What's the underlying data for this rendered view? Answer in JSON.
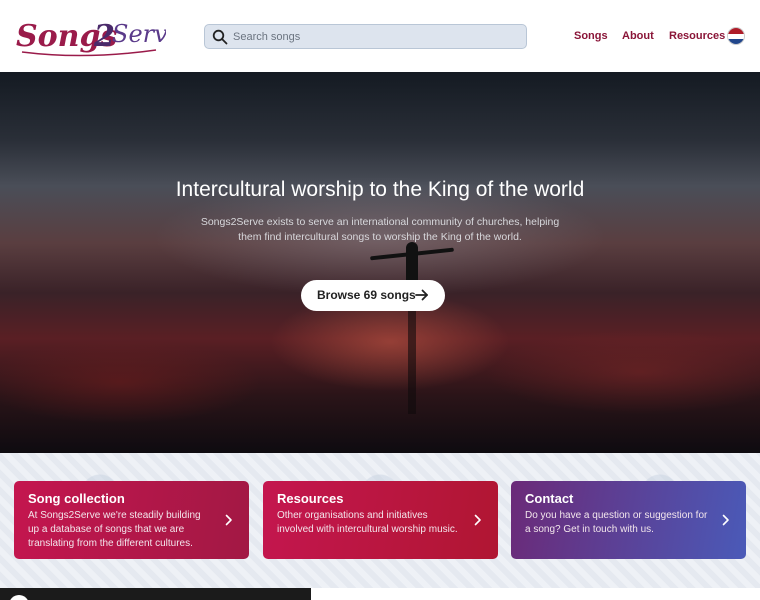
{
  "header": {
    "logo_text": "Songs2Serve",
    "search": {
      "placeholder": "Search songs",
      "value": ""
    },
    "nav": [
      {
        "label": "Songs"
      },
      {
        "label": "About"
      },
      {
        "label": "Resources"
      }
    ],
    "language_flag": "flag-netherlands-icon"
  },
  "hero": {
    "title": "Intercultural worship to the King of the world",
    "text": "Songs2Serve exists to serve an international community of churches, helping them find intercultural songs to worship the King of the world.",
    "button_label": "Browse 69 songs"
  },
  "cards": [
    {
      "title": "Song collection",
      "text": "At Songs2Serve we're steadily building up a database of songs that we are translating from the different cultures."
    },
    {
      "title": "Resources",
      "text": "Other organisations and initiatives involved with intercultural worship music."
    },
    {
      "title": "Contact",
      "text": "Do you have a question or suggestion for a song? Get in touch with us."
    }
  ],
  "colors": {
    "brand": "#8a1538",
    "card_red": "#c4164f",
    "card_purple": "#6b2a78",
    "card_blue": "#4a5ab8"
  }
}
